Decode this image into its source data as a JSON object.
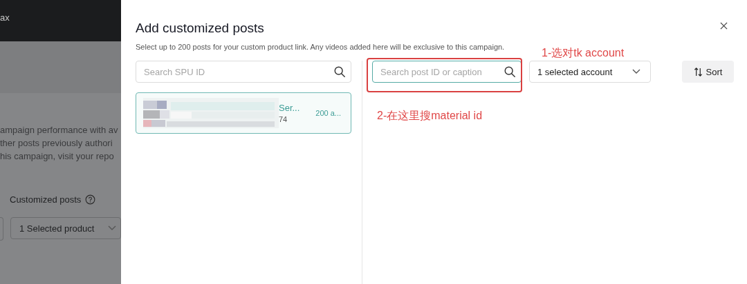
{
  "background": {
    "header_text": "ax",
    "paragraph_lines": [
      "ampaign performance with av",
      "ther posts previously authori",
      "his campaign, visit your repo"
    ],
    "section_label": "Customized posts",
    "product_select": "1 Selected product"
  },
  "dialog": {
    "title": "Add customized posts",
    "subtitle": "Select up to 200 posts for your custom product link. Any videos added here will be exclusive to this campaign.",
    "spu_search": {
      "placeholder": "Search SPU ID"
    },
    "products": [
      {
        "kind": "picture",
        "name": "Ser...",
        "id": "74",
        "count": "200 a...",
        "selected": true
      }
    ],
    "post_search": {
      "placeholder": "Search post ID or caption",
      "focused": true
    },
    "account_select": "1 selected account",
    "sort_button": "Sort"
  },
  "annotations": [
    {
      "text": "1-选对tk account"
    },
    {
      "text": "2-在这里搜material id"
    }
  ]
}
